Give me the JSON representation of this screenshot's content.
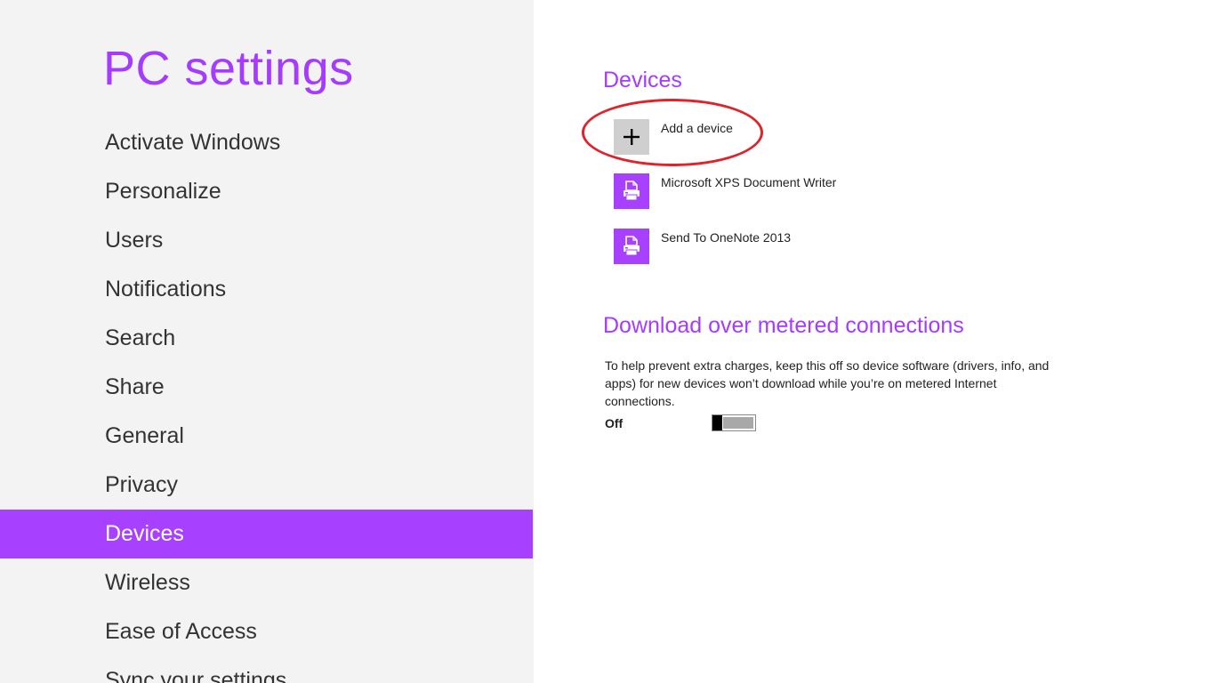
{
  "colors": {
    "accent": "#a53bff",
    "selected_bg": "#a741ff",
    "sidebar_bg": "#f3f3f3",
    "annotation_ring": "#e0222a"
  },
  "sidebar": {
    "title": "PC settings",
    "items": [
      {
        "label": "Activate Windows"
      },
      {
        "label": "Personalize"
      },
      {
        "label": "Users"
      },
      {
        "label": "Notifications"
      },
      {
        "label": "Search"
      },
      {
        "label": "Share"
      },
      {
        "label": "General"
      },
      {
        "label": "Privacy"
      },
      {
        "label": "Devices",
        "selected": true
      },
      {
        "label": "Wireless"
      },
      {
        "label": "Ease of Access"
      },
      {
        "label": "Sync your settings"
      }
    ]
  },
  "devices": {
    "title": "Devices",
    "add_label": "Add a device",
    "add_icon": "plus-icon",
    "list": [
      {
        "name": "Microsoft XPS Document Writer",
        "icon": "printer-icon"
      },
      {
        "name": "Send To OneNote 2013",
        "icon": "printer-icon"
      }
    ]
  },
  "metered": {
    "title": "Download over metered connections",
    "description": "To help prevent extra charges, keep this off so device software (drivers, info, and apps) for new devices won’t download while you’re on metered Internet connections.",
    "state_label": "Off",
    "enabled": false
  }
}
